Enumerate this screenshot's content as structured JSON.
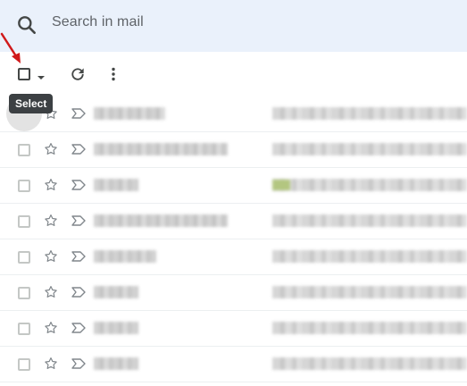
{
  "search": {
    "placeholder": "Search in mail"
  },
  "toolbar": {
    "select_tooltip": "Select",
    "icons": {
      "select": "checkbox-icon",
      "caret": "chevron-down-icon",
      "refresh": "refresh-icon",
      "more": "more-vert-icon"
    }
  },
  "colors": {
    "search_bg": "#eaf1fb",
    "tooltip_bg": "#3c4043",
    "annotation_arrow": "#d0191a",
    "icon": "#444746"
  },
  "email_rows": [
    {
      "starred": false,
      "important": false
    },
    {
      "starred": false,
      "important": false
    },
    {
      "starred": false,
      "important": false
    },
    {
      "starred": false,
      "important": false
    },
    {
      "starred": false,
      "important": false
    },
    {
      "starred": false,
      "important": false
    },
    {
      "starred": false,
      "important": false
    },
    {
      "starred": false,
      "important": false
    }
  ]
}
